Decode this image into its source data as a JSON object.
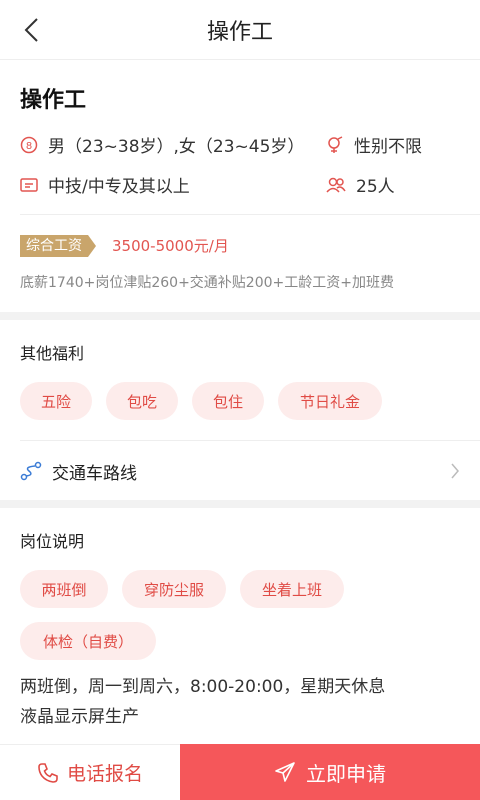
{
  "header": {
    "title": "操作工",
    "back_icon": "chevron-left-icon"
  },
  "job": {
    "title": "操作工",
    "age_requirement": "男（23~38岁）,女（23~45岁）",
    "gender": "性别不限",
    "education": "中技/中专及其以上",
    "headcount": "25人"
  },
  "salary": {
    "badge": "综合工资",
    "range": "3500-5000元/月",
    "detail": "底薪1740+岗位津贴260+交通补贴200+工龄工资+加班费"
  },
  "welfare": {
    "title": "其他福利",
    "tags": [
      "五险",
      "包吃",
      "包住",
      "节日礼金"
    ],
    "route_label": "交通车路线"
  },
  "description": {
    "title": "岗位说明",
    "tags": [
      "两班倒",
      "穿防尘服",
      "坐着上班",
      "体检（自费）"
    ],
    "lines": [
      "两班倒，周一到周六，8:00-20:00，星期天休息",
      "液晶显示屏生产"
    ]
  },
  "actions": {
    "call_label": "电话报名",
    "apply_label": "立即申请"
  },
  "colors": {
    "accent": "#e04b45",
    "apply_bg": "#f5575a",
    "badge_gold": "#c9a56b",
    "tag_bg": "#fdeceb"
  }
}
